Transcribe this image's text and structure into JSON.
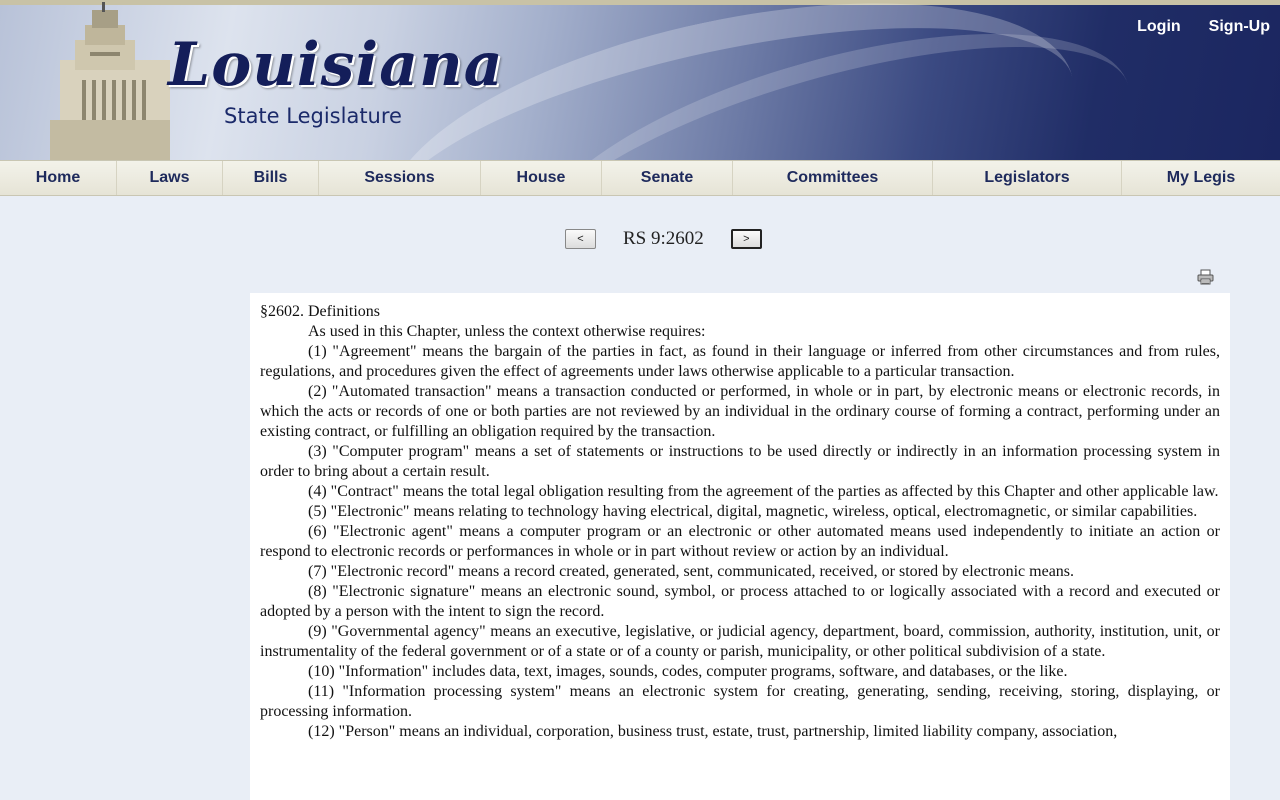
{
  "header": {
    "logo_title": "Louisiana",
    "logo_subtitle": "State Legislature",
    "login_label": "Login",
    "signup_label": "Sign-Up"
  },
  "nav": {
    "items": [
      {
        "label": "Home"
      },
      {
        "label": "Laws"
      },
      {
        "label": "Bills"
      },
      {
        "label": "Sessions"
      },
      {
        "label": "House"
      },
      {
        "label": "Senate"
      },
      {
        "label": "Committees"
      },
      {
        "label": "Legislators"
      },
      {
        "label": "My Legis"
      }
    ]
  },
  "pager": {
    "prev_label": "<",
    "citation": "RS 9:2602",
    "next_label": ">"
  },
  "toolbar": {
    "print_icon": "printer-icon"
  },
  "document": {
    "heading": "§2602.  Definitions",
    "paragraphs": [
      "As used in this Chapter, unless the context otherwise requires:",
      "(1)  \"Agreement\" means the bargain of the parties in fact, as found in their language or inferred from other circumstances and from rules, regulations, and procedures given the effect of agreements under laws otherwise applicable to a particular transaction.",
      "(2)  \"Automated transaction\" means a transaction conducted or performed, in whole or in part, by electronic means or electronic records, in which the acts or records of one or both parties are not reviewed by an individual in the ordinary course of forming a contract, performing under an existing contract, or fulfilling an obligation required by the transaction.",
      "(3)  \"Computer program\" means a set of statements or instructions to be used directly or indirectly in an information processing system in  order to bring about a certain result.",
      "(4)  \"Contract\" means the total legal obligation resulting from the agreement of the parties as affected by this Chapter and other applicable law.",
      "(5)  \"Electronic\" means relating to technology having electrical, digital, magnetic, wireless, optical, electromagnetic, or similar capabilities.",
      "(6)  \"Electronic agent\" means a computer program or an electronic or other automated means used independently to initiate an action or respond to electronic records or performances in whole or in part without review or action by an individual.",
      "(7)  \"Electronic record\" means a record created, generated, sent, communicated, received, or stored by electronic means.",
      "(8)  \"Electronic signature\" means an electronic sound, symbol, or process attached to or logically associated with a record and executed or adopted by a person with the intent to sign the record.",
      "(9)  \"Governmental agency\" means an executive, legislative, or judicial agency, department, board, commission, authority, institution, unit, or instrumentality of the federal government or of a state or of a county or parish, municipality, or other political subdivision of a state.",
      "(10)  \"Information\" includes data, text, images, sounds, codes, computer programs, software, and databases, or the like.",
      "(11)  \"Information processing system\" means an electronic system for creating, generating, sending, receiving, storing, displaying, or processing information.",
      "(12)  \"Person\" means an individual, corporation, business trust, estate, trust, partnership, limited liability company, association,"
    ]
  }
}
